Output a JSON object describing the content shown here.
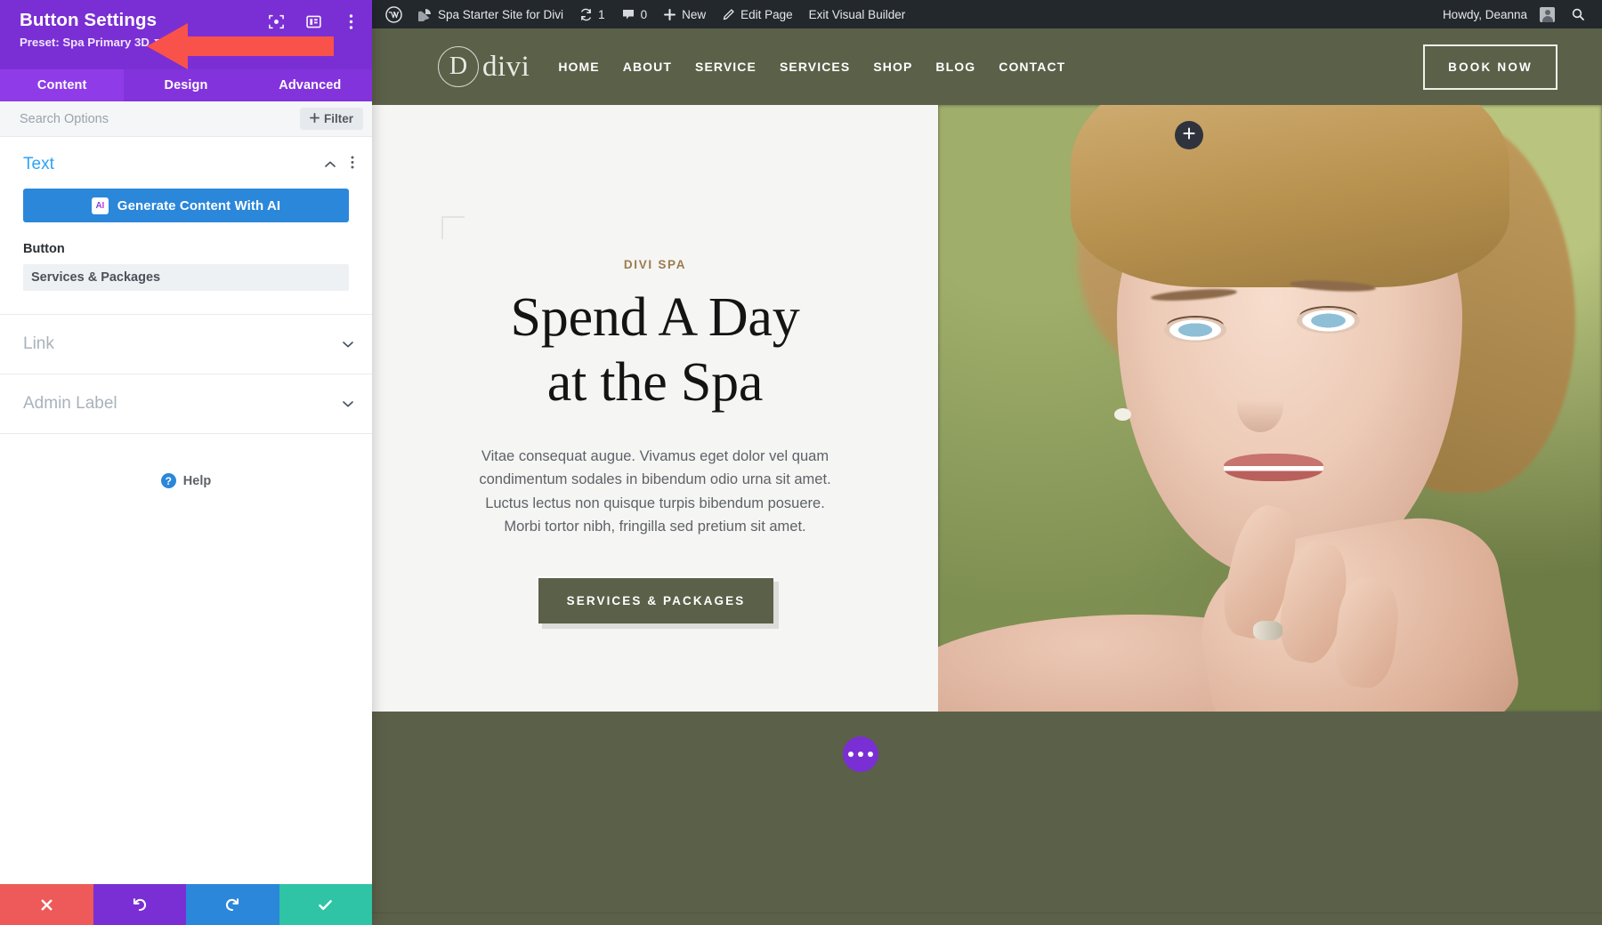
{
  "settings_panel": {
    "title": "Button Settings",
    "preset_label": "Preset: Spa Primary 3D",
    "header_icons": [
      {
        "name": "focus-icon"
      },
      {
        "name": "layout-panel-icon"
      },
      {
        "name": "more-options-icon"
      }
    ],
    "tabs": [
      {
        "label": "Content",
        "active": true
      },
      {
        "label": "Design",
        "active": false
      },
      {
        "label": "Advanced",
        "active": false
      }
    ],
    "search_placeholder": "Search Options",
    "filter_label": "Filter",
    "sections": [
      {
        "title": "Text",
        "expanded": true
      },
      {
        "title": "Link",
        "expanded": false
      },
      {
        "title": "Admin Label",
        "expanded": false
      }
    ],
    "ai_button_label": "Generate Content With AI",
    "ai_badge_text": "AI",
    "button_field": {
      "label": "Button",
      "value": "Services & Packages"
    },
    "help_label": "Help",
    "footer_buttons": [
      {
        "name": "cancel-button",
        "icon": "close-icon"
      },
      {
        "name": "undo-button",
        "icon": "undo-icon"
      },
      {
        "name": "redo-button",
        "icon": "redo-icon"
      },
      {
        "name": "save-button",
        "icon": "check-icon"
      }
    ],
    "colors": {
      "header_purple": "#7a2fd4",
      "tabs_purple": "#8333db",
      "tab_active_purple": "#8f3ce8",
      "accent_blue": "#2b87da",
      "cancel_red": "#ee5a5a",
      "save_green": "#2ec4a5",
      "arrow_red": "#f9524a"
    }
  },
  "admin_bar": {
    "wp_logo": "wordpress-logo-icon",
    "site_name": "Spa Starter Site for Divi",
    "updates_count": "1",
    "comments_count": "0",
    "new_label": "New",
    "edit_page_label": "Edit Page",
    "exit_builder_label": "Exit Visual Builder",
    "howdy_label": "Howdy, Deanna",
    "search_icon": "search-icon"
  },
  "site_header": {
    "logo_letter": "D",
    "logo_word": "divi",
    "nav": [
      {
        "label": "HOME"
      },
      {
        "label": "ABOUT"
      },
      {
        "label": "SERVICE"
      },
      {
        "label": "SERVICES"
      },
      {
        "label": "SHOP"
      },
      {
        "label": "BLOG"
      },
      {
        "label": "CONTACT"
      }
    ],
    "cta_label": "BOOK NOW",
    "background_color": "#5b6049"
  },
  "hero": {
    "eyebrow": "DIVI SPA",
    "heading_line1": "Spend A Day",
    "heading_line2": "at the Spa",
    "paragraph": "Vitae consequat augue. Vivamus eget dolor vel quam condimentum sodales in bibendum odio urna sit amet. Luctus lectus non quisque turpis bibendum posuere. Morbi tortor nibh, fringilla sed pretium sit amet.",
    "cta_label": "SERVICES & PACKAGES",
    "eyebrow_color": "#9b7b4d",
    "background_color": "#f5f5f3"
  },
  "builder_controls": {
    "add_module_icon": "plus-icon",
    "page_settings_icon": "ellipsis-icon"
  }
}
